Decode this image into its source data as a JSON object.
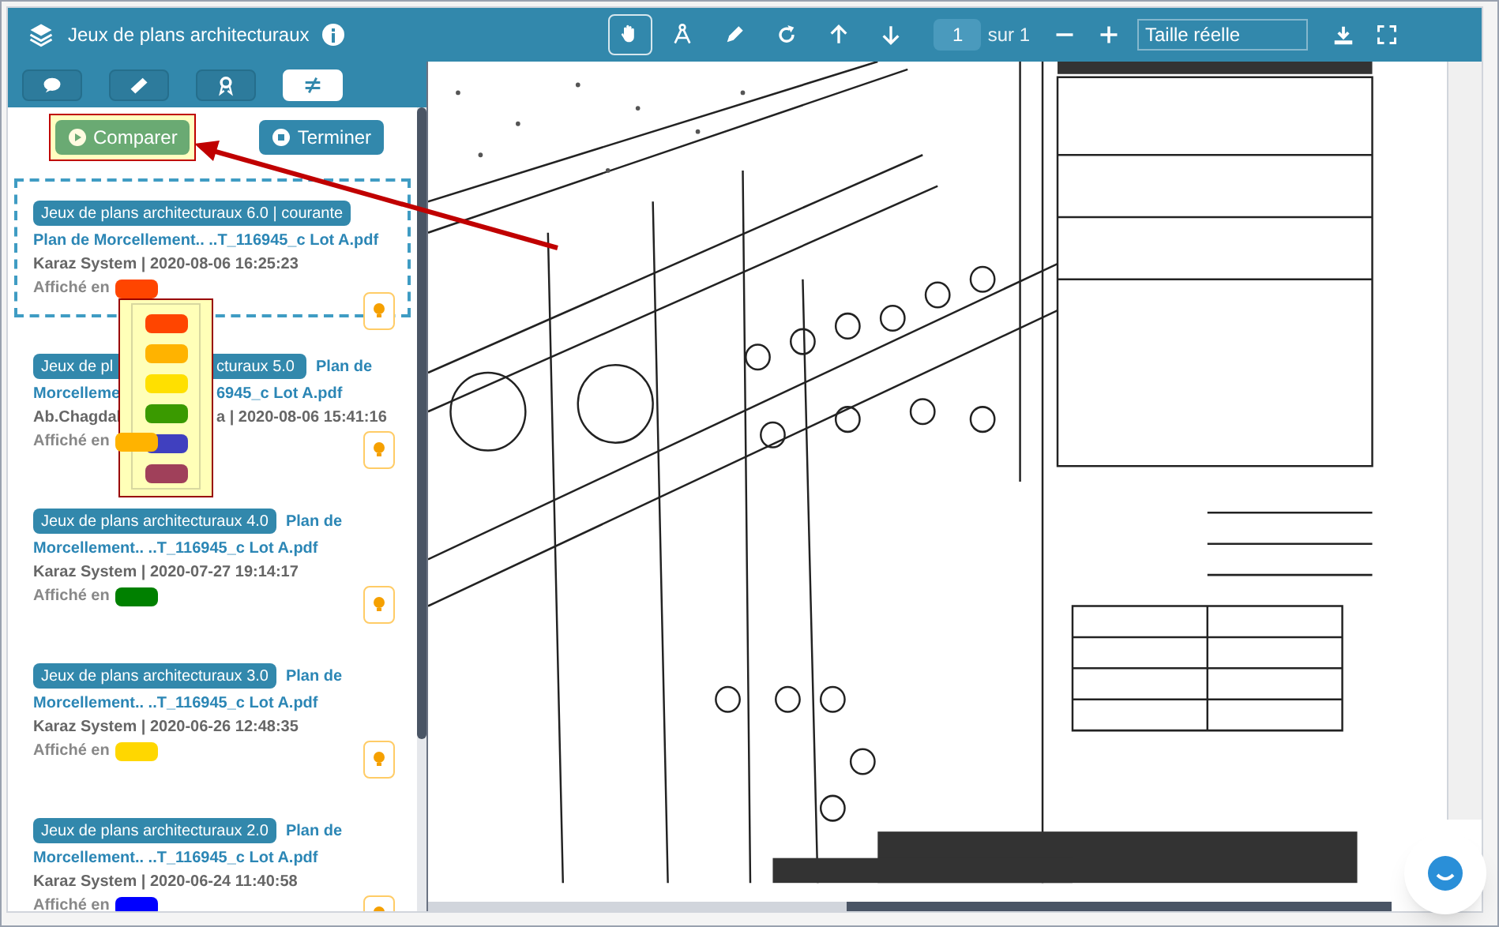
{
  "header": {
    "title": "Jeux de plans architecturaux",
    "page": "1",
    "page_total": "sur 1",
    "zoom": "Taille réelle",
    "tools": [
      {
        "kind": "hand",
        "selected": true
      },
      {
        "kind": "compass",
        "selected": false
      },
      {
        "kind": "pen",
        "selected": false
      },
      {
        "kind": "redo",
        "selected": false
      },
      {
        "kind": "up",
        "selected": false
      },
      {
        "kind": "down",
        "selected": false
      }
    ]
  },
  "panel_tabs": [
    {
      "kind": "comment",
      "selected": false
    },
    {
      "kind": "ruler",
      "selected": false
    },
    {
      "kind": "award",
      "selected": false
    },
    {
      "kind": "compare",
      "selected": true
    }
  ],
  "actions": {
    "compare": "Comparer",
    "finish": "Terminer"
  },
  "versions": [
    {
      "badge": [
        "Jeux de plans architecturaux 6.0 | courante"
      ],
      "file": [
        [
          "Plan de Morcellement.. ..T_116945_c Lot A.pdf"
        ]
      ],
      "meta": [
        "Karaz System | 2020-08-06 16:25:23"
      ],
      "shown_in": "Affiché en",
      "color": "#ff4500",
      "current": true
    },
    {
      "badge": [
        "Jeux de pl",
        "cturaux 5.0"
      ],
      "file": [
        [
          "Plan de"
        ],
        [
          "Morcelleme",
          "6945_c Lot A.pdf"
        ]
      ],
      "meta": [
        "Ab.Chagdal",
        "a | 2020-08-06 15:41:16"
      ],
      "shown_in": "Affiché en",
      "color": "#ffb300",
      "current": false
    },
    {
      "badge": [
        "Jeux de plans architecturaux 4.0"
      ],
      "file": [
        [
          "Plan de"
        ],
        [
          "Morcellement.. ..T_116945_c Lot A.pdf"
        ]
      ],
      "meta": [
        "Karaz System | 2020-07-27 19:14:17"
      ],
      "shown_in": "Affiché en",
      "color": "#008000",
      "current": false
    },
    {
      "badge": [
        "Jeux de plans architecturaux 3.0"
      ],
      "file": [
        [
          "Plan de"
        ],
        [
          "Morcellement.. ..T_116945_c Lot A.pdf"
        ]
      ],
      "meta": [
        "Karaz System | 2020-06-26 12:48:35"
      ],
      "shown_in": "Affiché en",
      "color": "#ffd700",
      "current": false
    },
    {
      "badge": [
        "Jeux de plans architecturaux 2.0"
      ],
      "file": [
        [
          "Plan de"
        ],
        [
          "Morcellement.. ..T_116945_c Lot A.pdf"
        ]
      ],
      "meta": [
        "Karaz System | 2020-06-24 11:40:58"
      ],
      "shown_in": "Affiché en",
      "color": "#0000ff",
      "current": false
    }
  ],
  "color_menu": [
    {
      "color": "#ff4500"
    },
    {
      "color": "#ffb300"
    },
    {
      "color": "#ffe000"
    },
    {
      "color": "#3a9a00"
    },
    {
      "color": "#4040bf"
    },
    {
      "color": "#a0405a"
    }
  ]
}
